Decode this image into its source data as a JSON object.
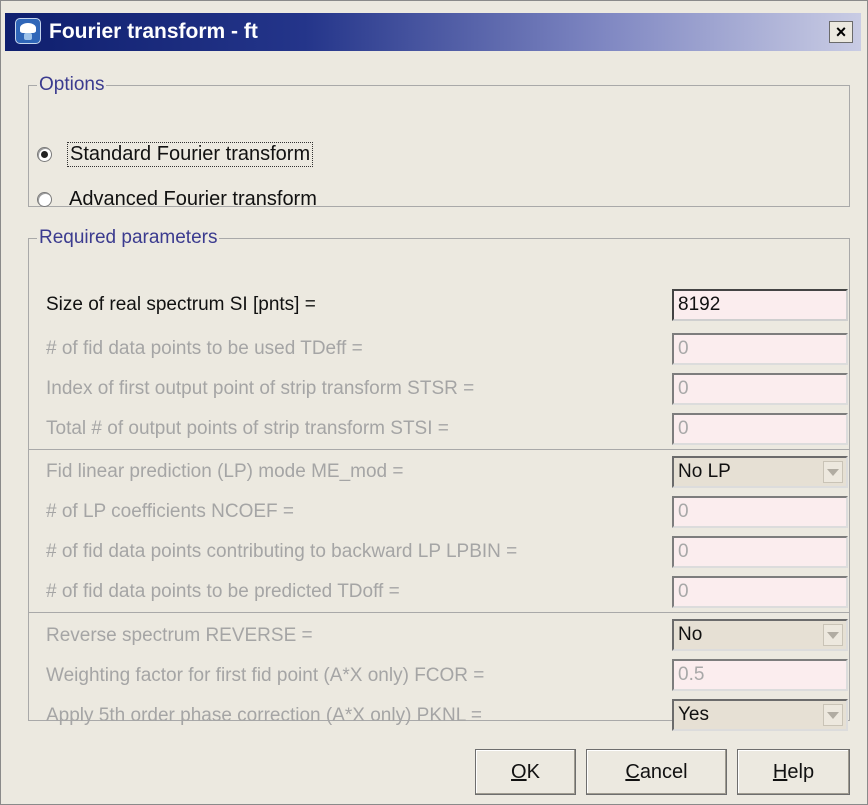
{
  "window": {
    "title": "Fourier transform - ft",
    "close_label": "×",
    "app_icon": "topspin-icon"
  },
  "options": {
    "legend": "Options",
    "items": [
      {
        "label": "Standard Fourier transform",
        "checked": true
      },
      {
        "label": "Advanced Fourier transform",
        "checked": false
      }
    ]
  },
  "params": {
    "legend": "Required parameters",
    "rows": [
      {
        "label": "Size of real spectrum SI [pnts] =",
        "value": "8192"
      },
      {
        "label": "# of fid data points to be used TDeff =",
        "value": "0"
      },
      {
        "label": "Index of first output point of strip transform STSR =",
        "value": "0"
      },
      {
        "label": "Total # of output points of strip transform STSI =",
        "value": "0"
      },
      {
        "label": "Fid linear prediction (LP) mode ME_mod =",
        "value": "No LP"
      },
      {
        "label": "# of LP coefficients NCOEF =",
        "value": "0"
      },
      {
        "label": "# of fid data points contributing to backward LP LPBIN =",
        "value": "0"
      },
      {
        "label": "# of fid data points to be predicted TDoff =",
        "value": "0"
      },
      {
        "label": "Reverse spectrum REVERSE =",
        "value": "No"
      },
      {
        "label": "Weighting factor for first fid point (A*X only) FCOR =",
        "value": "0.5"
      },
      {
        "label": "Apply 5th order phase correction (A*X only) PKNL =",
        "value": "Yes"
      }
    ]
  },
  "buttons": {
    "ok": {
      "mnemonic": "O",
      "rest": "K"
    },
    "cancel": {
      "mnemonic": "C",
      "rest": "ancel"
    },
    "help": {
      "mnemonic": "H",
      "rest": "elp"
    }
  },
  "colors": {
    "title_gradient_start": "#0f1f6e",
    "field_bg": "#fbedee",
    "legend": "#3b3b8f"
  }
}
